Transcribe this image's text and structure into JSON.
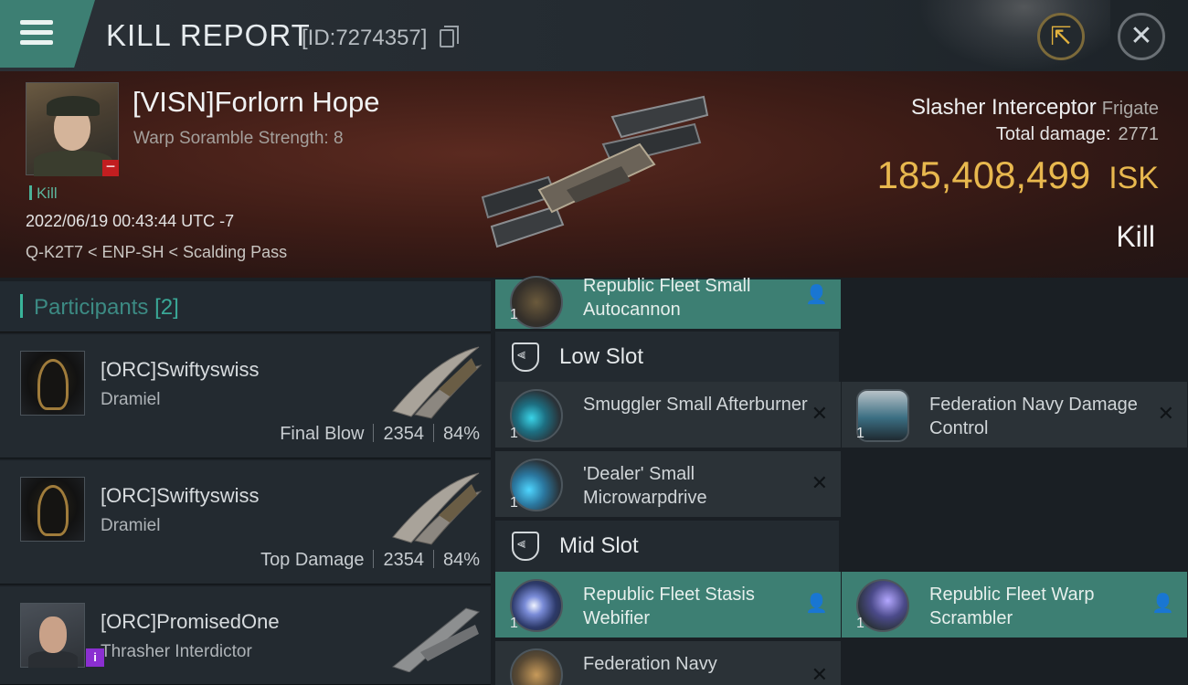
{
  "header": {
    "title": "KILL REPORT",
    "id_text": "[ID:7274357]"
  },
  "victim": {
    "name": "[VISN]Forlorn Hope",
    "subtitle": "Warp Soramble Strength: 8",
    "tag": "Kill",
    "datetime": "2022/06/19 00:43:44 UTC -7",
    "location": "Q-K2T7 < ENP-SH < Scalding Pass",
    "ship_name": "Slasher Interceptor",
    "ship_class": "Frigate",
    "total_damage_label": "Total damage:",
    "total_damage": "2771",
    "isk_value": "185,408,499",
    "isk_unit": "ISK",
    "result": "Kill"
  },
  "participants": {
    "title": "Participants",
    "count": "[2]",
    "items": [
      {
        "name": "[ORC]Swiftyswiss",
        "ship": "Dramiel",
        "role": "Final Blow",
        "damage": "2354",
        "percent": "84%"
      },
      {
        "name": "[ORC]Swiftyswiss",
        "ship": "Dramiel",
        "role": "Top Damage",
        "damage": "2354",
        "percent": "84%"
      },
      {
        "name": "[ORC]PromisedOne",
        "ship": "Thrasher Interdictor"
      }
    ]
  },
  "fitting": {
    "high_partial": {
      "qty": "1",
      "label": "Republic Fleet Small Autocannon"
    },
    "low_slot": {
      "title": "Low Slot",
      "items": [
        {
          "qty": "1",
          "label": "Smuggler Small Afterburner"
        },
        {
          "qty": "1",
          "label": "Federation Navy Damage Control"
        },
        {
          "qty": "1",
          "label": "'Dealer' Small Microwarpdrive"
        }
      ]
    },
    "mid_slot": {
      "title": "Mid Slot",
      "items": [
        {
          "qty": "1",
          "label": "Republic Fleet Stasis Webifier"
        },
        {
          "qty": "1",
          "label": "Republic Fleet Warp Scrambler"
        },
        {
          "qty": "",
          "label": "Federation Navy"
        }
      ]
    }
  },
  "icons": {
    "menu": "hamburger-icon",
    "copy": "copy-icon",
    "share": "share-icon",
    "close": "close-icon",
    "pilot": "pilot-icon",
    "remove": "remove-icon",
    "info": "info-icon",
    "slot": "shield-slot-icon"
  },
  "colors": {
    "accent": "#3d7f73",
    "isk": "#e8b84e",
    "kill_tag": "#5bb59c",
    "minus_badge": "#c21e20",
    "info_badge": "#8b2fd1"
  }
}
